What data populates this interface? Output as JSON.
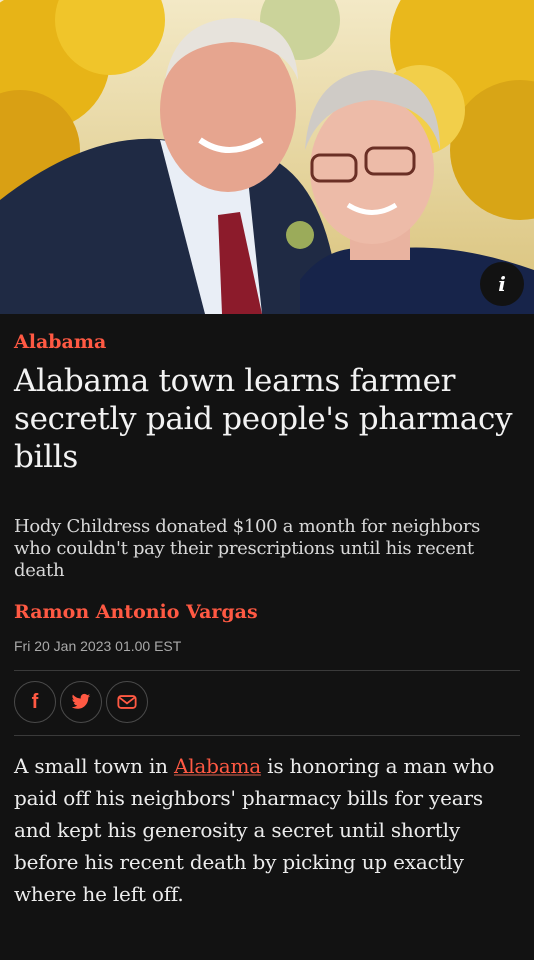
{
  "hero": {
    "info_icon": "info-icon",
    "info_label": "i"
  },
  "article": {
    "kicker": "Alabama",
    "headline": "Alabama town learns farmer secretly paid people's pharmacy bills",
    "standfirst": "Hody Childress donated $100 a month for neighbors who couldn't pay their prescriptions until his recent death",
    "byline": "Ramon Antonio Vargas",
    "date": "Fri 20 Jan 2023 01.00 EST",
    "share": [
      {
        "icon": "facebook-icon",
        "label": "f"
      },
      {
        "icon": "twitter-icon",
        "label": ""
      },
      {
        "icon": "email-icon",
        "label": ""
      }
    ],
    "body_before_link": "A small town in ",
    "body_link": "Alabama",
    "body_after_link": " is honoring a man who paid off his neighbors' pharmacy bills for years and kept his generosity a secret until shortly before his recent death by picking up exactly where he left off."
  },
  "colors": {
    "accent": "#ff5943",
    "background": "#121212"
  }
}
